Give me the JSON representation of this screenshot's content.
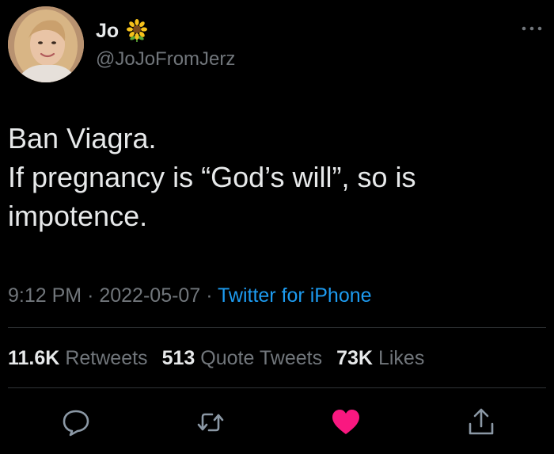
{
  "user": {
    "display_name": "Jo",
    "name_emoji": "sunflower-icon",
    "handle": "@JoJoFromJerz"
  },
  "tweet": {
    "lines": [
      "Ban Viagra.",
      "If pregnancy is “God’s will”, so is",
      "impotence."
    ],
    "time": "9:12 PM",
    "separator": "·",
    "date": "2022-05-07",
    "source": "Twitter for iPhone"
  },
  "stats": {
    "retweets_count": "11.6K",
    "retweets_label": "Retweets",
    "quotes_count": "513",
    "quotes_label": "Quote Tweets",
    "likes_count": "73K",
    "likes_label": "Likes"
  },
  "actions": {
    "reply_icon": "reply-icon",
    "retweet_icon": "retweet-icon",
    "like_icon": "heart-icon",
    "share_icon": "share-icon",
    "like_active": true
  },
  "colors": {
    "background": "#000000",
    "text": "#e7e9ea",
    "secondary": "#71767b",
    "link": "#1d9bf0",
    "divider": "#2f3336",
    "like": "#f91880"
  }
}
